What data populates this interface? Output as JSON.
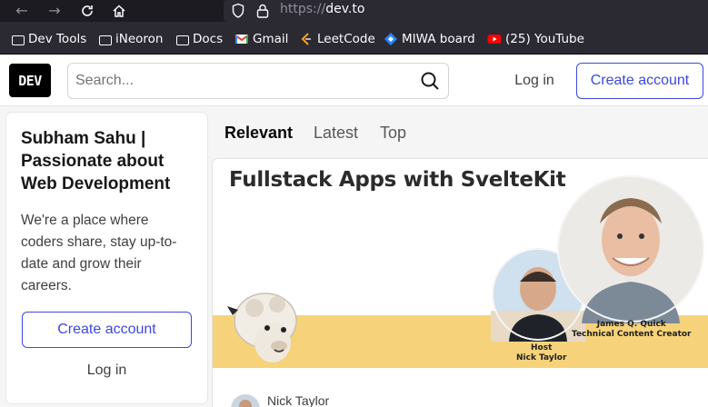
{
  "browser": {
    "url_protocol": "https://",
    "url_host": "dev.to",
    "bookmarks": [
      {
        "label": "Dev Tools",
        "icon": "folder-icon"
      },
      {
        "label": "iNeoron",
        "icon": "folder-icon"
      },
      {
        "label": "Docs",
        "icon": "folder-icon"
      },
      {
        "label": "Gmail",
        "icon": "gmail-icon"
      },
      {
        "label": "LeetCode",
        "icon": "leetcode-icon"
      },
      {
        "label": "MIWA board",
        "icon": "jira-icon"
      },
      {
        "label": "(25) YouTube",
        "icon": "youtube-icon"
      }
    ]
  },
  "header": {
    "logo_text": "DEV",
    "search_placeholder": "Search...",
    "login_label": "Log in",
    "create_account_label": "Create account"
  },
  "sidebar": {
    "title": "Subham Sahu | Passionate about Web Development",
    "description": "We're a place where coders share, stay up-to-date and grow their careers.",
    "create_account_label": "Create account",
    "login_label": "Log in"
  },
  "feed": {
    "tabs": [
      {
        "label": "Relevant",
        "active": true
      },
      {
        "label": "Latest",
        "active": false
      },
      {
        "label": "Top",
        "active": false
      }
    ]
  },
  "article": {
    "cover_title": "Fullstack Apps with SvelteKit",
    "host_caption_line1": "Host",
    "host_caption_line2": "Nick Taylor",
    "guest_caption_line1": "James Q. Quick",
    "guest_caption_line2": "Technical Content Creator",
    "author_name": "Nick Taylor"
  },
  "colors": {
    "accent": "#3b49df",
    "chrome_dark": "#1c1b22",
    "cover_band": "#f6d37a"
  }
}
